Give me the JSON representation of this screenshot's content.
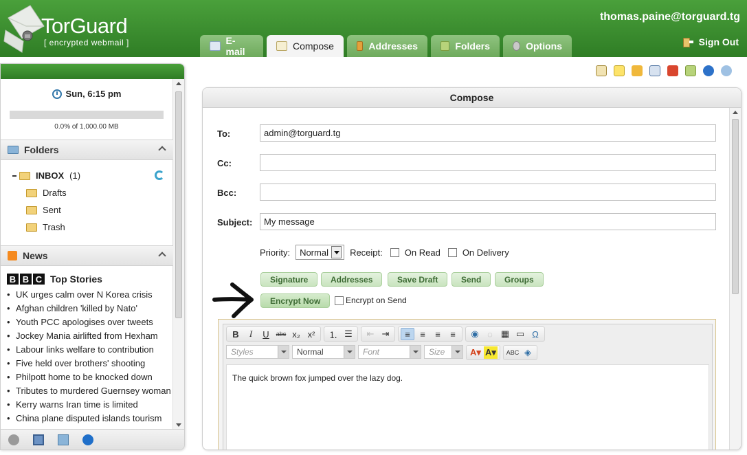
{
  "app": {
    "brand": "TorGuard",
    "tagline": "[ encrypted webmail ]",
    "user_email": "thomas.paine@torguard.tg",
    "sign_out": "Sign Out"
  },
  "tabs": [
    {
      "label": "E-mail",
      "icon": "envelope-icon",
      "active": false
    },
    {
      "label": "Compose",
      "icon": "compose-icon",
      "active": true
    },
    {
      "label": "Addresses",
      "icon": "address-book-icon",
      "active": false
    },
    {
      "label": "Folders",
      "icon": "folder-icon",
      "active": false
    },
    {
      "label": "Options",
      "icon": "gear-icon",
      "active": false
    }
  ],
  "sidebar": {
    "clock": "Sun, 6:15 pm",
    "quota": "0.0% of 1,000.00 MB",
    "quota_fraction": 0.0,
    "folders_title": "Folders",
    "inbox": "INBOX",
    "inbox_count": "(1)",
    "folders": [
      "Drafts",
      "Sent",
      "Trash"
    ],
    "news_title": "News",
    "bbc_letters": [
      "B",
      "B",
      "C"
    ],
    "top_stories": "Top Stories",
    "news": [
      "UK urges calm over N Korea crisis",
      "Afghan children 'killed by Nato'",
      "Youth PCC apologises over tweets",
      "Jockey Mania airlifted from Hexham",
      "Labour links welfare to contribution",
      "Five held over brothers' shooting",
      "Philpott home to be knocked down",
      "Tributes to murdered Guernsey woman",
      "Kerry warns Iran time is limited",
      "China plane disputed islands tourism"
    ]
  },
  "compose": {
    "title": "Compose",
    "to_label": "To:",
    "to_value": "admin@torguard.tg",
    "cc_label": "Cc:",
    "cc_value": "",
    "bcc_label": "Bcc:",
    "bcc_value": "",
    "subject_label": "Subject:",
    "subject_value": "My message",
    "priority_label": "Priority:",
    "priority_value": "Normal",
    "receipt_label": "Receipt:",
    "on_read": "On Read",
    "on_delivery": "On Delivery",
    "buttons": {
      "signature": "Signature",
      "addresses": "Addresses",
      "save_draft": "Save Draft",
      "send": "Send",
      "groups": "Groups",
      "encrypt_now": "Encrypt Now"
    },
    "encrypt_on_send": "Encrypt on Send"
  },
  "editor": {
    "styles": "Styles",
    "format": "Normal",
    "font": "Font",
    "size": "Size",
    "body": "The quick brown fox jumped over the lazy dog."
  }
}
